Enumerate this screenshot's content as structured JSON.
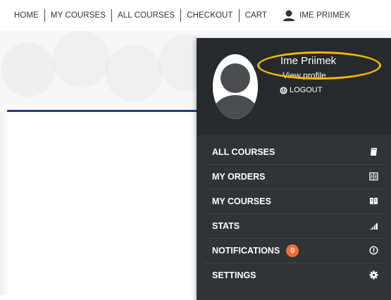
{
  "nav": {
    "items": [
      {
        "label": "HOME"
      },
      {
        "label": "MY COURSES"
      },
      {
        "label": "ALL COURSES"
      },
      {
        "label": "CHECKOUT"
      },
      {
        "label": "CART"
      }
    ],
    "user_label": "IME PRIIMEK"
  },
  "dropdown": {
    "username": "Ime Priimek",
    "view_profile": "View profile",
    "logout": "LOGOUT",
    "menu": [
      {
        "label": "ALL COURSES",
        "icon": "book-icon"
      },
      {
        "label": "MY ORDERS",
        "icon": "orders-icon"
      },
      {
        "label": "MY COURSES",
        "icon": "open-book-icon"
      },
      {
        "label": "STATS",
        "icon": "signal-bars-icon"
      },
      {
        "label": "NOTIFICATIONS",
        "icon": "alert-icon",
        "badge": "0"
      },
      {
        "label": "SETTINGS",
        "icon": "gear-icon"
      }
    ]
  },
  "colors": {
    "panel_bg": "#2f3436",
    "profile_bg": "#262a2c",
    "badge": "#f26b3a",
    "highlight": "#f5b800",
    "accent_line": "#1f3d8f"
  }
}
